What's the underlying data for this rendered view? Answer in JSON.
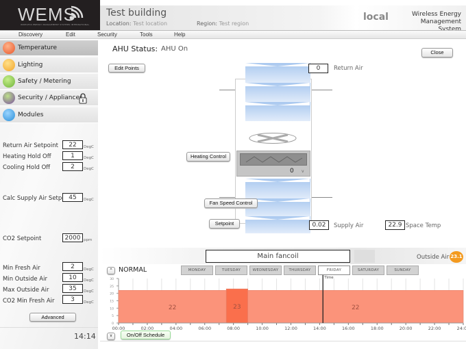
{
  "header": {
    "logo": "WEMS",
    "logo_subtitle": "WIRELESS ENERGY MANAGEMENT SYSTEMS INTERNATIONAL",
    "building": "Test building",
    "location_label": "Location:",
    "location_value": "Test location",
    "region_label": "Region:",
    "region_value": "Test region",
    "connection": "local",
    "system_name_line1": "Wireless Energy",
    "system_name_line2": "Management System"
  },
  "menu": [
    "Discovery",
    "Edit",
    "Security",
    "Tools",
    "Help"
  ],
  "sidebar": {
    "nav": [
      {
        "label": "Temperature",
        "icon": "temperature-icon",
        "color": "#e8562a",
        "selected": true
      },
      {
        "label": "Lighting",
        "icon": "lighting-icon",
        "color": "#f2a428",
        "selected": false
      },
      {
        "label": "Safety / Metering",
        "icon": "safety-icon",
        "color": "#6fb33a",
        "selected": false
      },
      {
        "label": "Security / Appliances",
        "icon": "security-icon",
        "color": "#7a4fa0",
        "selected": false,
        "locked": true
      },
      {
        "label": "Modules",
        "icon": "modules-icon",
        "color": "#2a8fd8",
        "selected": false
      }
    ],
    "params": [
      {
        "label": "Return Air Setpoint",
        "value": "22",
        "unit": "DegC"
      },
      {
        "label": "Heating Hold Off",
        "value": "1",
        "unit": "DegC"
      },
      {
        "label": "Cooling Hold Off",
        "value": "2",
        "unit": "DegC"
      },
      {
        "label": "Calc Supply Air Setpoint",
        "value": "45",
        "unit": "DegC"
      },
      {
        "label": "CO2 Setpoint",
        "value": "2000",
        "unit": "ppm"
      },
      {
        "label": "Min Fresh Air",
        "value": "2",
        "unit": "DegC"
      },
      {
        "label": "Min Outside Air",
        "value": "10",
        "unit": "DegC"
      },
      {
        "label": "Max Outside Air",
        "value": "35",
        "unit": "DegC"
      },
      {
        "label": "CO2 Min Fresh Air",
        "value": "3",
        "unit": "DegC"
      }
    ],
    "advanced_label": "Advanced",
    "clock": "14:14"
  },
  "ahu": {
    "status_label": "AHU Status:",
    "status_value": "AHU On",
    "edit_points_label": "Edit Points",
    "close_label": "Close",
    "return_air_value": "0",
    "return_air_label": "Return Air",
    "heating_control_label": "Heating Control",
    "heater_value": "0",
    "heater_unit": "v",
    "fan_speed_label": "Fan Speed Control",
    "setpoint_label": "Setpoint",
    "supply_air_value": "0.02",
    "supply_air_label": "Supply Air",
    "space_temp_value": "22.9",
    "space_temp_label": "Space Temp"
  },
  "schedule": {
    "name": "Main fancoil",
    "outside_air_label": "Outside Air",
    "outside_air_value": "23.1",
    "mode": "NORMAL",
    "up_label": "^",
    "down_label": "v",
    "days": [
      "MONDAY",
      "TUESDAY",
      "WEDNESDAY",
      "THURSDAY",
      "FRIDAY",
      "SATURDAY",
      "SUNDAY"
    ],
    "selected_day": "FRIDAY",
    "onoff_label": "On/Off Schedule",
    "colors": {
      "normal": "#fb937a",
      "boost": "#fa6f4c"
    }
  },
  "chart_data": {
    "type": "bar",
    "title": "",
    "xlabel": "",
    "ylabel": "",
    "ylim": [
      0,
      30
    ],
    "yticks": [
      0,
      5,
      10,
      15,
      20,
      25,
      30
    ],
    "xlim": [
      0,
      24
    ],
    "xtick_labels": [
      "00:00",
      "02:00",
      "04:00",
      "06:00",
      "08:00",
      "10:00",
      "12:00",
      "14:00",
      "16:00",
      "18:00",
      "20:00",
      "22:00",
      "24:00"
    ],
    "segments": [
      {
        "start": 0,
        "end": 7.5,
        "value": 22,
        "label": "22"
      },
      {
        "start": 7.5,
        "end": 9,
        "value": 23,
        "label": "23"
      },
      {
        "start": 9,
        "end": 24,
        "value": 22,
        "label": "22"
      }
    ],
    "time_marker": {
      "label": "Time",
      "value": 14.23
    }
  }
}
